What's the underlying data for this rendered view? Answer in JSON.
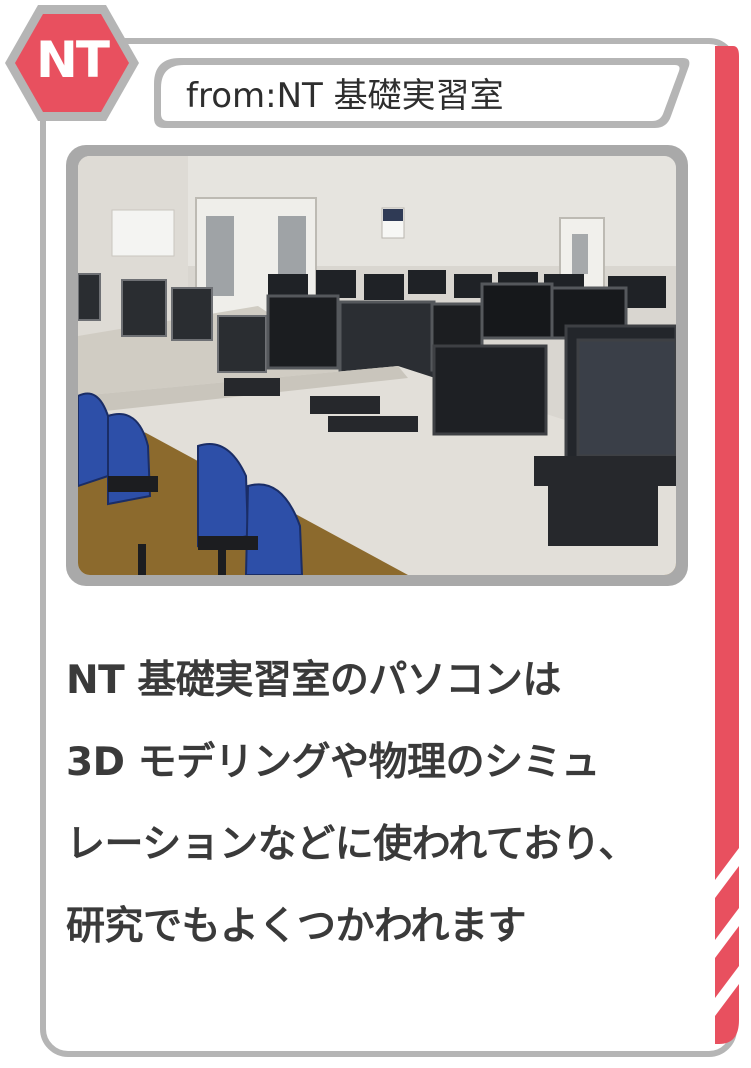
{
  "badge": {
    "label": "NT",
    "color": "#e8505f"
  },
  "header": {
    "title": "from:NT 基礎実習室"
  },
  "photo": {
    "icon": "computer-lab-photo"
  },
  "caption": {
    "lines": [
      "NT 基礎実習室のパソコンは",
      "3D モデリングや物理のシミュ",
      "レーションなどに使われており、",
      "研究でもよくつかわれます"
    ]
  },
  "colors": {
    "accent": "#e8505f",
    "frame": "#b5b5b5",
    "text": "#3a3a3a"
  }
}
